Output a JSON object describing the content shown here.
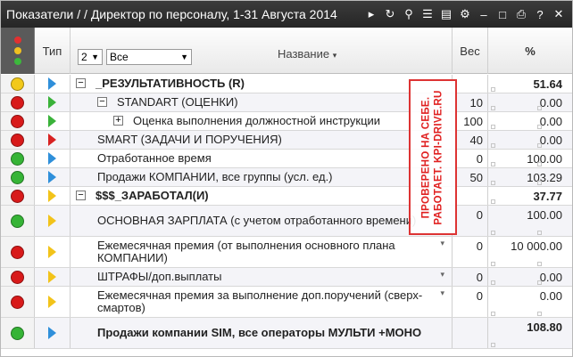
{
  "titlebar": {
    "title": "Показатели / / Директор по персоналу, 1-31 Августа 2014"
  },
  "colors": {
    "green": "#36b436",
    "red": "#d81a1a",
    "yellow": "#f2c91a",
    "blue_arrow": "#2f8fda",
    "red_arrow": "#d82222",
    "yellow_arrow": "#f2c31a",
    "green_arrow": "#3ab23a"
  },
  "header": {
    "type_label": "Тип",
    "level_value": "2",
    "filter_value": "Все",
    "name_label": "Название",
    "weight_label": "Вес",
    "percent_label": "%"
  },
  "rows": [
    {
      "status": "yellow",
      "arrow": "blue",
      "level": 0,
      "toggle": "−",
      "name": "_РЕЗУЛЬТАТИВНОСТЬ (R)",
      "bold": true,
      "weight": "",
      "percent": "51.64"
    },
    {
      "status": "red",
      "arrow": "green",
      "level": 1,
      "toggle": "−",
      "name": "STANDART (ОЦЕНКИ)",
      "bold": false,
      "weight": "10",
      "percent": "0.00"
    },
    {
      "status": "red",
      "arrow": "green",
      "level": 2,
      "toggle": "+",
      "name": "Оценка выполнения должностной инструкции",
      "bold": false,
      "weight": "100",
      "percent": "0.00"
    },
    {
      "status": "red",
      "arrow": "red",
      "level": 1,
      "name": "SMART (ЗАДАЧИ И ПОРУЧЕНИЯ)",
      "bold": false,
      "weight": "40",
      "percent": "0.00"
    },
    {
      "status": "green",
      "arrow": "blue",
      "level": 1,
      "name": "Отработанное время",
      "bold": false,
      "weight": "0",
      "percent": "100.00"
    },
    {
      "status": "green",
      "arrow": "blue",
      "level": 1,
      "name": "Продажи КОМПАНИИ, все группы (усл. ед.)",
      "bold": false,
      "weight": "50",
      "percent": "103.29"
    },
    {
      "status": "red",
      "arrow": "yellow",
      "level": 0,
      "toggle": "−",
      "name": "$$$_ЗАРАБОТАЛ(И)",
      "bold": true,
      "weight": "",
      "percent": "37.77"
    },
    {
      "status": "green",
      "arrow": "yellow",
      "level": 1,
      "name": "ОСНОВНАЯ ЗАРПЛАТА (с учетом отработанного времени)",
      "bold": false,
      "weight": "0",
      "percent": "100.00",
      "tall": true
    },
    {
      "status": "red",
      "arrow": "yellow",
      "level": 1,
      "name": "Ежемесячная премия (от выполнения основного плана КОМПАНИИ)",
      "bold": false,
      "weight": "0",
      "percent": "10 000.00",
      "tall": true,
      "dropdown": true
    },
    {
      "status": "red",
      "arrow": "yellow",
      "level": 1,
      "name": "ШТРАФЫ/доп.выплаты",
      "bold": false,
      "weight": "0",
      "percent": "0.00",
      "dropdown": true
    },
    {
      "status": "red",
      "arrow": "yellow",
      "level": 1,
      "name": "Ежемесячная премия за выполнение доп.поручений (сверх-смартов)",
      "bold": false,
      "weight": "0",
      "percent": "0.00",
      "tall": true,
      "dropdown": true
    },
    {
      "status": "green",
      "arrow": "blue",
      "level": 1,
      "name": "Продажи компании SIM, все операторы МУЛЬТИ +МОНО",
      "bold": true,
      "weight": "",
      "percent": "108.80",
      "tall": true
    }
  ],
  "stamp": {
    "line1": "ПРОВЕРЕНО НА СЕБЕ.",
    "line2": "РАБОТАЕТ. KPI-DRIVE.RU"
  }
}
